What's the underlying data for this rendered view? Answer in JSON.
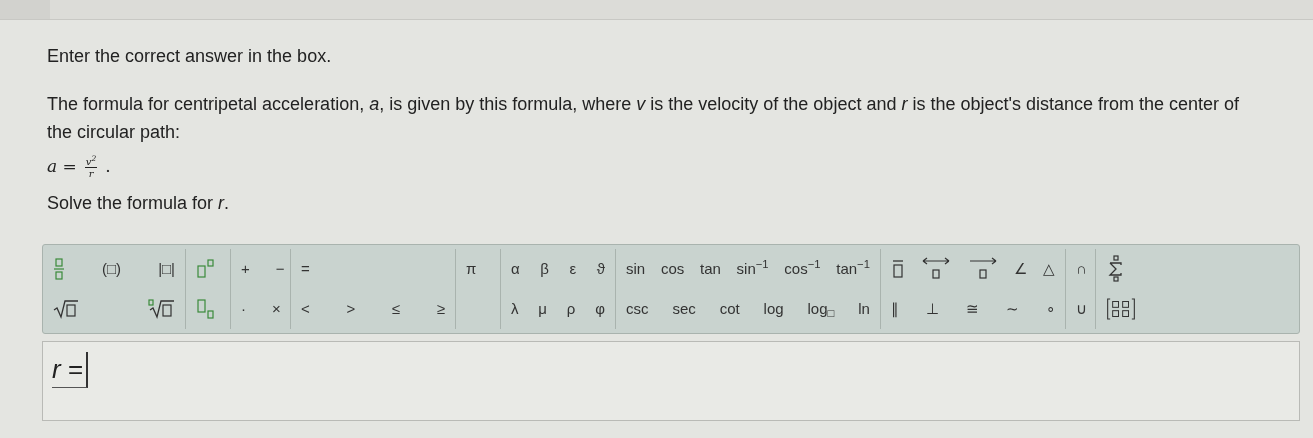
{
  "instruction": "Enter the correct answer in the box.",
  "paragraph": "The formula for centripetal acceleration, *a*, is given by this formula, where *v* is the velocity of the object and *r* is the object's distance from the center of the circular path:",
  "formula": {
    "lhs": "a =",
    "numerator": "v$^{2}$",
    "denominator": "r",
    "tail": "."
  },
  "prompt": "Solve the formula for *r*.",
  "toolbar": [
    {
      "rows": [
        [
          {
            "kind": "fraction"
          },
          {
            "kind": "text",
            "label": "(□)"
          },
          {
            "kind": "text",
            "label": "|□|"
          }
        ],
        [
          {
            "kind": "root"
          },
          {
            "kind": "nthroot"
          }
        ]
      ]
    },
    {
      "rows": [
        [
          {
            "kind": "power"
          }
        ],
        [
          {
            "kind": "subscript"
          }
        ]
      ]
    },
    {
      "rows": [
        [
          {
            "kind": "text",
            "label": "+"
          },
          {
            "kind": "text",
            "label": "−"
          }
        ],
        [
          {
            "kind": "text",
            "label": "·"
          },
          {
            "kind": "text",
            "label": "×"
          }
        ]
      ]
    },
    {
      "rows": [
        [
          {
            "kind": "text",
            "label": "="
          }
        ],
        [
          {
            "kind": "text",
            "label": "<"
          },
          {
            "kind": "text",
            "label": ">"
          },
          {
            "kind": "text",
            "label": "≤"
          },
          {
            "kind": "text",
            "label": "≥"
          }
        ]
      ]
    },
    {
      "rows": [
        [
          {
            "kind": "text",
            "label": "π"
          }
        ],
        []
      ]
    },
    {
      "rows": [
        [
          {
            "kind": "text",
            "label": "α"
          },
          {
            "kind": "text",
            "label": "β"
          },
          {
            "kind": "text",
            "label": "ε"
          },
          {
            "kind": "text",
            "label": "ϑ"
          }
        ],
        [
          {
            "kind": "text",
            "label": "λ"
          },
          {
            "kind": "text",
            "label": "μ"
          },
          {
            "kind": "text",
            "label": "ρ"
          },
          {
            "kind": "text",
            "label": "φ"
          }
        ]
      ]
    },
    {
      "rows": [
        [
          {
            "kind": "text",
            "label": "sin"
          },
          {
            "kind": "text",
            "label": "cos"
          },
          {
            "kind": "text",
            "label": "tan"
          },
          {
            "kind": "text",
            "label": "sin$^{−1}$"
          },
          {
            "kind": "text",
            "label": "cos$^{−1}$"
          },
          {
            "kind": "text",
            "label": "tan$^{−1}$"
          }
        ],
        [
          {
            "kind": "text",
            "label": "csc"
          },
          {
            "kind": "text",
            "label": "sec"
          },
          {
            "kind": "text",
            "label": "cot"
          },
          {
            "kind": "text",
            "label": "log"
          },
          {
            "kind": "text",
            "label": "log$_{□}$"
          },
          {
            "kind": "text",
            "label": "ln"
          }
        ]
      ]
    },
    {
      "rows": [
        [
          {
            "kind": "overbar"
          },
          {
            "kind": "line"
          },
          {
            "kind": "ray"
          },
          {
            "kind": "text",
            "label": "∠"
          },
          {
            "kind": "text",
            "label": "△"
          }
        ],
        [
          {
            "kind": "text",
            "label": "∥"
          },
          {
            "kind": "text",
            "label": "⊥"
          },
          {
            "kind": "text",
            "label": "≅"
          },
          {
            "kind": "text",
            "label": "∼"
          },
          {
            "kind": "text",
            "label": "∘"
          }
        ]
      ]
    },
    {
      "rows": [
        [
          {
            "kind": "text",
            "label": "∩"
          }
        ],
        [
          {
            "kind": "text",
            "label": "∪"
          }
        ]
      ]
    },
    {
      "rows": [
        [
          {
            "kind": "sum"
          }
        ],
        [
          {
            "kind": "matrix"
          }
        ]
      ]
    }
  ],
  "answer": {
    "value": "*r* ="
  }
}
